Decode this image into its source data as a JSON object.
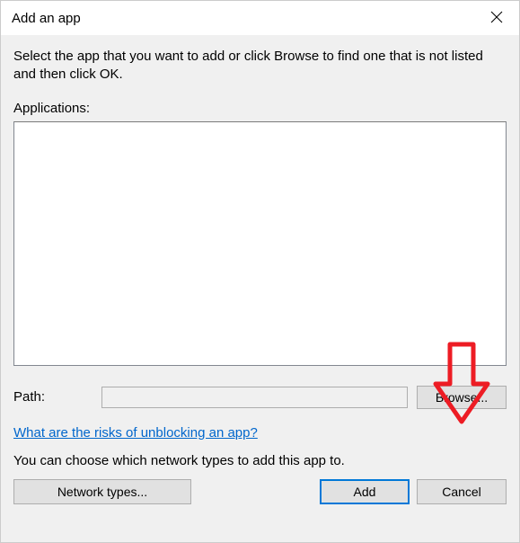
{
  "window": {
    "title": "Add an app"
  },
  "content": {
    "instruction": "Select the app that you want to add or click Browse to find one that is not listed and then click OK.",
    "apps_label": "Applications:",
    "path_label": "Path:",
    "path_value": "",
    "browse_label": "Browse...",
    "help_link": "What are the risks of unblocking an app?",
    "network_desc": "You can choose which network types to add this app to.",
    "network_types_label": "Network types...",
    "add_label": "Add",
    "cancel_label": "Cancel"
  },
  "annotation": {
    "arrow_color": "#ed1c24",
    "arrow_target": "browse-button"
  }
}
